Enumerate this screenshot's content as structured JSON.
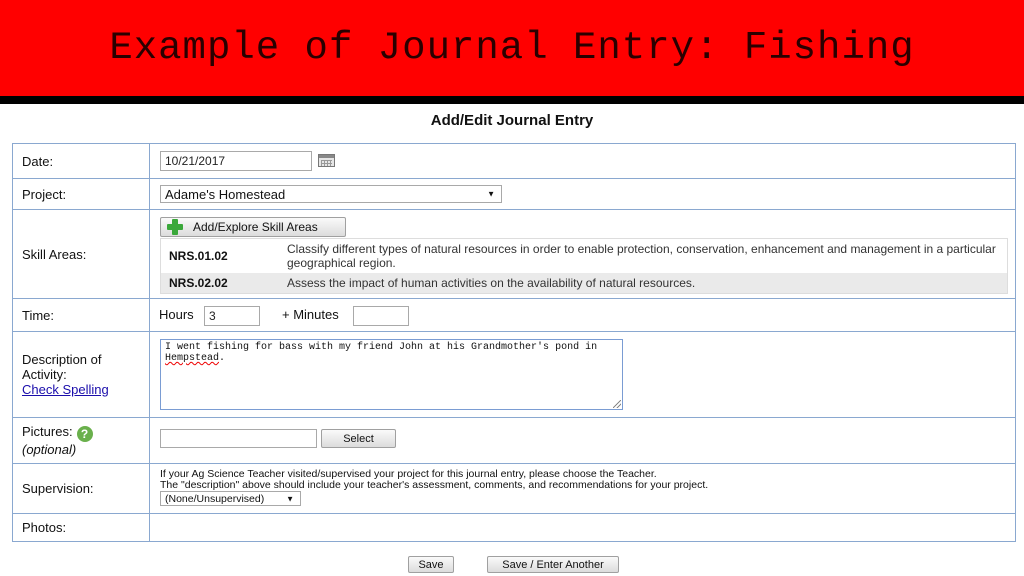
{
  "slide": {
    "title": "Example of Journal Entry: Fishing"
  },
  "form": {
    "title": "Add/Edit Journal Entry",
    "date": {
      "label": "Date:",
      "value": "10/21/2017"
    },
    "project": {
      "label": "Project:",
      "selected": "Adame's Homestead"
    },
    "skill_areas": {
      "label": "Skill Areas:",
      "add_button": "Add/Explore Skill Areas",
      "items": [
        {
          "code": "NRS.01.02",
          "description": "Classify different types of natural resources in order to enable protection, conservation, enhancement and management in a particular geographical region."
        },
        {
          "code": "NRS.02.02",
          "description": "Assess the impact of human activities on the availability of natural resources."
        }
      ]
    },
    "time": {
      "label": "Time:",
      "hours_label": "Hours",
      "hours_value": "3",
      "minutes_label": "+ Minutes",
      "minutes_value": ""
    },
    "description": {
      "label_line1": "Description of",
      "label_line2": "Activity:",
      "check_spelling": "Check Spelling",
      "text_before": " I went fishing for bass with my friend John at his Grandmother's pond in ",
      "text_misspelled": "Hempstead",
      "text_after": "."
    },
    "pictures": {
      "label": "Pictures:",
      "help_glyph": "?",
      "optional": "(optional)",
      "select_button": "Select"
    },
    "supervision": {
      "label": "Supervision:",
      "line1": "If your Ag Science Teacher visited/supervised your project for this journal entry, please choose the Teacher.",
      "line2": "The \"description\" above should include your teacher's assessment, comments, and recommendations for your project.",
      "selected": "(None/Unsupervised)"
    },
    "photos": {
      "label": "Photos:"
    },
    "buttons": {
      "save": "Save",
      "save_another": "Save / Enter Another"
    }
  },
  "colors": {
    "banner": "#ff0000",
    "border": "#8aa8d0",
    "link": "#1a0dab",
    "accent_green": "#3aa83a"
  }
}
